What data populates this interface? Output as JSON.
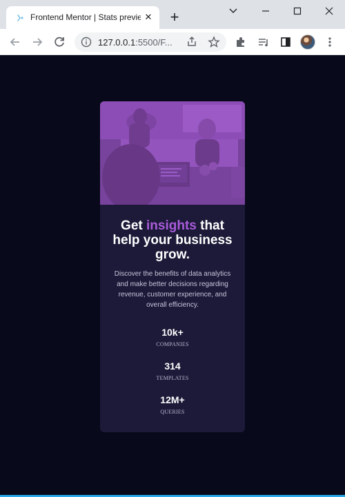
{
  "browser": {
    "tab_title": "Frontend Mentor | Stats preview card component",
    "url_main": "127.0.0.1",
    "url_rest": ":5500/F..."
  },
  "card": {
    "title_before": "Get ",
    "title_accent": "insights",
    "title_after": " that help your business grow.",
    "description": "Discover the benefits of data analytics and make better decisions regarding revenue, customer experience, and overall efficiency.",
    "stats": [
      {
        "value": "10k+",
        "label": "COMPANIES"
      },
      {
        "value": "314",
        "label": "TEMPLATES"
      },
      {
        "value": "12M+",
        "label": "QUERIES"
      }
    ]
  },
  "colors": {
    "page_bg": "#08091b",
    "card_bg": "#1c1a38",
    "accent": "#aa5cdb"
  }
}
